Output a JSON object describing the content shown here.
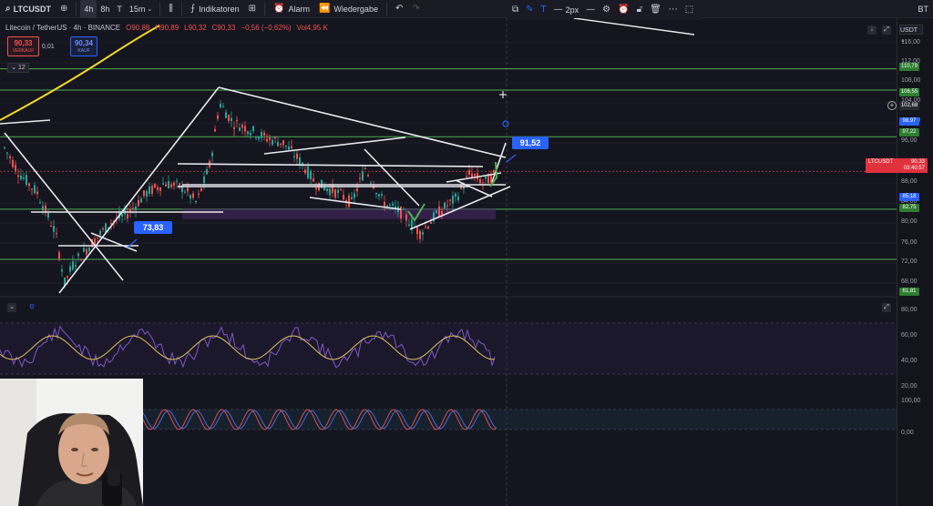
{
  "topbar": {
    "symbol": "LTCUSDT",
    "add_symbol_icon": "plus-circle-icon",
    "timeframes": [
      {
        "label": "4h",
        "active": true
      },
      {
        "label": "8h",
        "active": false
      },
      {
        "label": "T",
        "active": false
      },
      {
        "label": "15m",
        "active": false
      }
    ],
    "chart_type_icon": "candles-icon",
    "indicators_label": "Indikatoren",
    "layout_icon": "grid-icon",
    "alert_label": "Alarm",
    "replay_label": "Wiedergabe",
    "undo_icon": "undo-icon",
    "redo_icon": "redo-icon",
    "right_label": "BT"
  },
  "drawing_toolbar": {
    "line_width_label": "2px",
    "icons": [
      "templates-icon",
      "pencil-icon",
      "text-icon",
      "line-style-icon",
      "settings-icon",
      "alert-add-icon",
      "lock-icon",
      "trash-icon",
      "more-icon",
      "frame-icon"
    ]
  },
  "legend": {
    "title": "Litecoin / TetherUS · 4h · BINANCE",
    "open": "O90,88",
    "high": "H90,89",
    "low": "L90,32",
    "close": "C90,33",
    "change": "−0,56 (−0,62%)",
    "volume": "Vol4,95 K"
  },
  "trade_panel": {
    "sell_price": "90,33",
    "sell_label": "VERKAUF",
    "spread": "0,01",
    "buy_price": "90,34",
    "buy_label": "KAUF",
    "indicator_count": "12"
  },
  "price_axis": {
    "currency": "USDT",
    "ticks": [
      "116,00",
      "112,00",
      "108,00",
      "104,00",
      "100,00",
      "96,00",
      "92,00",
      "88,00",
      "84,00",
      "80,00",
      "76,00",
      "72,00",
      "68,00"
    ],
    "tags": [
      {
        "text": "110,79",
        "color": "#2e7d32"
      },
      {
        "text": "106,55",
        "color": "#2e7d32"
      },
      {
        "text": "102,68",
        "color": "#2a2a35"
      },
      {
        "text": "98,97",
        "color": "#2962ff"
      },
      {
        "text": "97,22",
        "color": "#2e7d32"
      },
      {
        "text": "85,18",
        "color": "#2962ff"
      },
      {
        "text": "82,75",
        "color": "#2e7d32"
      },
      {
        "text": "61,81",
        "color": "#2e7d32"
      }
    ],
    "symbol_tag": {
      "symbol": "LTCUSDT",
      "price": "90,33",
      "countdown": "03:40:57"
    },
    "rsi_ticks": [
      "80,00",
      "60,00",
      "40,00",
      "20,00"
    ],
    "stoch_ticks": [
      "100,00",
      "0,00"
    ]
  },
  "annotations": {
    "low_callout": "73,83",
    "high_callout": "91,52"
  },
  "colors": {
    "background": "#15151f",
    "bull": "#26a69a",
    "bear": "#ef5350",
    "support": "#4caf50",
    "accent": "#2962ff",
    "ma_line": "#f0d72a"
  },
  "panel_controls": {
    "collapse_icon": "chevron-down-icon",
    "settings_icon": "settings-icon",
    "arrow_down_icon": "arrow-down-icon",
    "maximize_icon": "maximize-icon"
  }
}
